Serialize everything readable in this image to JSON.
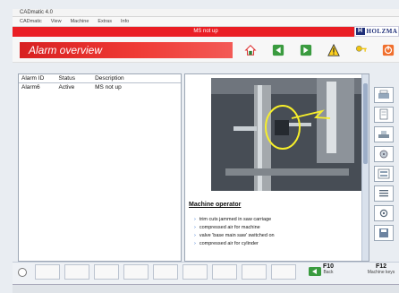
{
  "window": {
    "title": "CADmatic 4.0"
  },
  "menu": {
    "items": [
      "CADmatic",
      "View",
      "Machine",
      "Extras",
      "Info"
    ]
  },
  "status": {
    "message": "MS not up"
  },
  "brand": {
    "logo": "HOLZMA",
    "color": "#1f2f79"
  },
  "header": {
    "title": "Alarm overview",
    "accent_color": "#e82424"
  },
  "toolbar": [
    {
      "icon": "home-icon"
    },
    {
      "icon": "arrow-left-icon"
    },
    {
      "icon": "arrow-right-icon"
    },
    {
      "icon": "warning-icon"
    },
    {
      "icon": "key-icon"
    },
    {
      "icon": "exit-icon"
    }
  ],
  "alarms": {
    "headers": [
      "Alarm ID",
      "Status",
      "Description"
    ],
    "rows": [
      [
        "Alarm6",
        "Active",
        "MS not up"
      ]
    ]
  },
  "detail": {
    "section_title": "Machine operator",
    "actions": [
      "trim cuts jammed in saw carriage",
      "compressed air for machine",
      "valve 'base main saw' switched on",
      "compressed air for cylinder"
    ]
  },
  "function_keys": {
    "f10_label": "F10",
    "f10_caption": "Back",
    "f12_label": "F12",
    "f12_caption": "Machine keys"
  },
  "taskbar": {
    "left": "",
    "center": "",
    "right": ""
  }
}
